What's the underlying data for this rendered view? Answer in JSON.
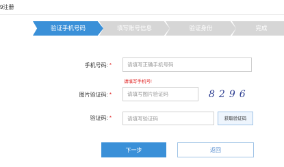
{
  "page": {
    "title": "9注册"
  },
  "steps": [
    {
      "label": "验证手机号码"
    },
    {
      "label": "填写账号信息"
    },
    {
      "label": "验证身份"
    },
    {
      "label": "完成"
    }
  ],
  "form": {
    "phone": {
      "label": "手机号码:",
      "required_mark": "*",
      "placeholder": "请填写正确手机号码",
      "error": "请填写手机号!"
    },
    "captcha": {
      "label": "图片验证码:",
      "required_mark": "*",
      "placeholder": "请填写图片验证码",
      "image_text": "8296"
    },
    "sms_code": {
      "label": "验证码:",
      "required_mark": "*",
      "placeholder": "请填写验证码",
      "get_code_label": "获取验证码"
    }
  },
  "actions": {
    "next_label": "下一步",
    "back_label": "返回"
  },
  "colors": {
    "accent": "#3a90d8",
    "step_inactive": "#d6d6d6",
    "error": "#e02020"
  }
}
